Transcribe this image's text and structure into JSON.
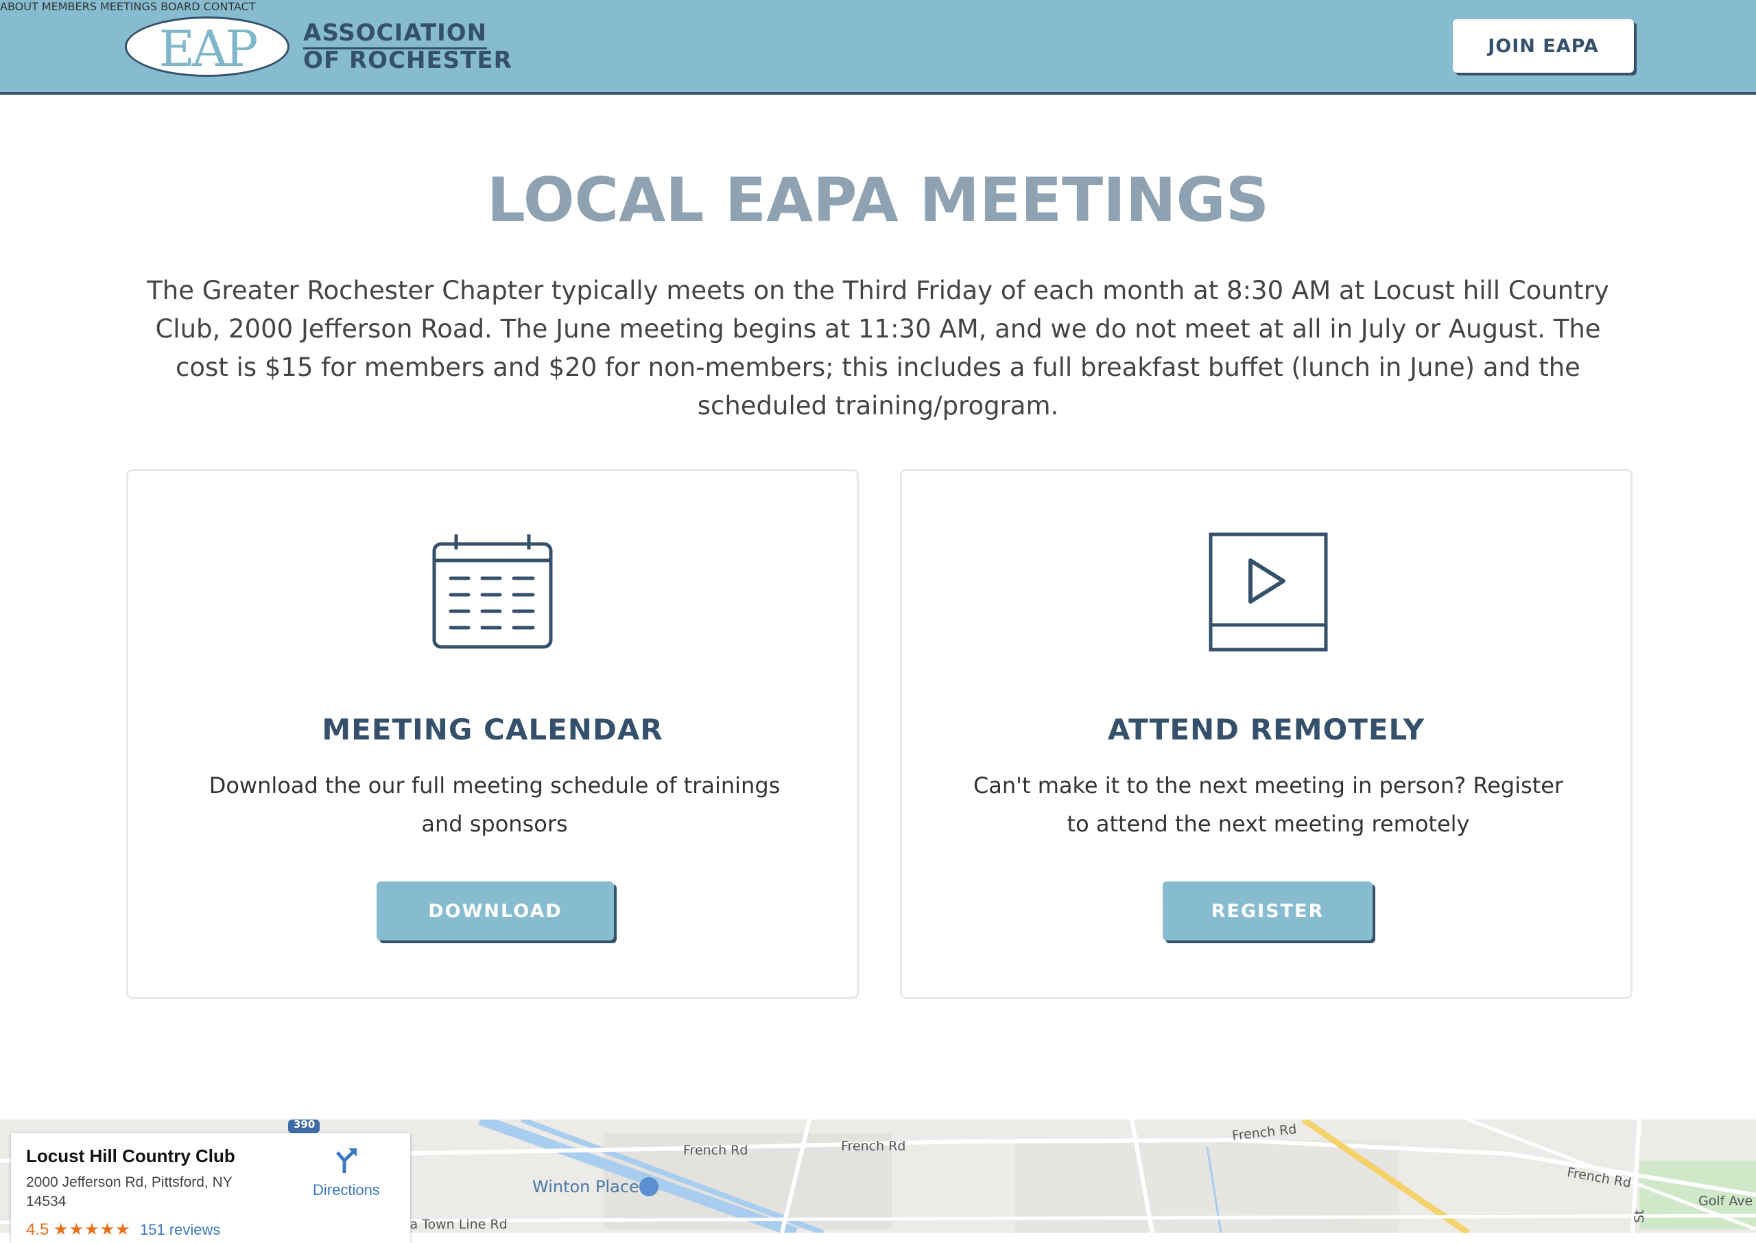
{
  "header": {
    "logo_mark": "EAP",
    "logo_line1": "ASSOCIATION",
    "logo_line2": "OF ROCHESTER",
    "nav": [
      {
        "label": "ABOUT"
      },
      {
        "label": "MEMBERS"
      },
      {
        "label": "MEETINGS"
      },
      {
        "label": "BOARD"
      },
      {
        "label": "CONTACT"
      }
    ],
    "cta_label": "JOIN EAPA"
  },
  "main": {
    "title": "LOCAL EAPA MEETINGS",
    "intro": "The Greater Rochester Chapter typically meets on the Third Friday of each month at 8:30 AM at Locust hill Country Club, 2000 Jefferson Road. The June meeting begins at 11:30 AM, and we do not meet at all in July or August. The cost is $15 for members and $20 for non-members; this includes a full breakfast buffet (lunch in June) and the scheduled training/program.",
    "cards": [
      {
        "icon": "calendar-icon",
        "title": "MEETING CALENDAR",
        "description": "Download the our full meeting schedule of trainings and sponsors",
        "button": "DOWNLOAD"
      },
      {
        "icon": "video-play-icon",
        "title": "ATTEND REMOTELY",
        "description": "Can't make it to the next meeting in person? Register to attend the next meeting remotely",
        "button": "REGISTER"
      }
    ]
  },
  "map": {
    "place_name": "Locust Hill Country Club",
    "address": "2000 Jefferson Rd, Pittsford, NY 14534",
    "rating": "4.5",
    "stars": "★★★★★",
    "reviews": "151 reviews",
    "directions_label": "Directions",
    "labels": {
      "route_shield": "390",
      "french_rd_1": "French Rd",
      "french_rd_2": "French Rd",
      "french_rd_3": "French Rd",
      "french_rd_4": "French Rd",
      "golf_ave": "Golf Ave",
      "winton_place": "Winton Place",
      "town_line_rd": "ta Town Line Rd",
      "st": "St"
    }
  },
  "colors": {
    "header_bg": "#87bcd0",
    "navy": "#34506b",
    "title_gray": "#8ea2b1",
    "button_blue": "#87bcd0"
  }
}
